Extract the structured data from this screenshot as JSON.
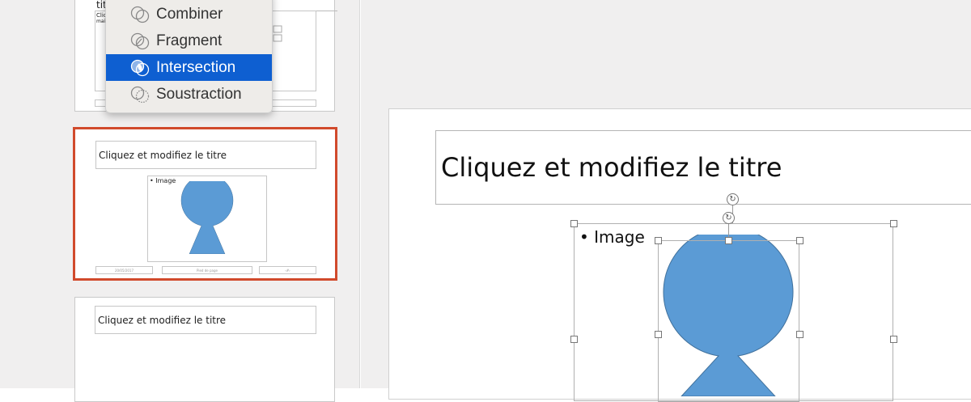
{
  "menu": {
    "items": [
      {
        "label": "Combiner",
        "icon": "combine-shapes-icon",
        "active": false
      },
      {
        "label": "Fragment",
        "icon": "fragment-shapes-icon",
        "active": false
      },
      {
        "label": "Intersection",
        "icon": "intersect-shapes-icon",
        "active": true
      },
      {
        "label": "Soustraction",
        "icon": "subtract-shapes-icon",
        "active": false
      }
    ],
    "active_color": "#0e5fd1"
  },
  "thumbnails": [
    {
      "title_partial": "titre",
      "text_partial": "Clic",
      "text_partial2": "mais"
    },
    {
      "title": "Cliquez et modifiez le titre",
      "bullet": "• Image",
      "footer_left": "20/05/2017",
      "footer_center": "Pied de page",
      "footer_right": "‹#›",
      "selected": true
    },
    {
      "title": "Cliquez et modifiez le titre"
    }
  ],
  "slide": {
    "title": "Cliquez et modifiez le titre",
    "bullet": "• Image"
  },
  "colors": {
    "selection_border": "#d14a2c",
    "shape_fill": "#5b9bd5",
    "shape_stroke": "#41719c"
  }
}
